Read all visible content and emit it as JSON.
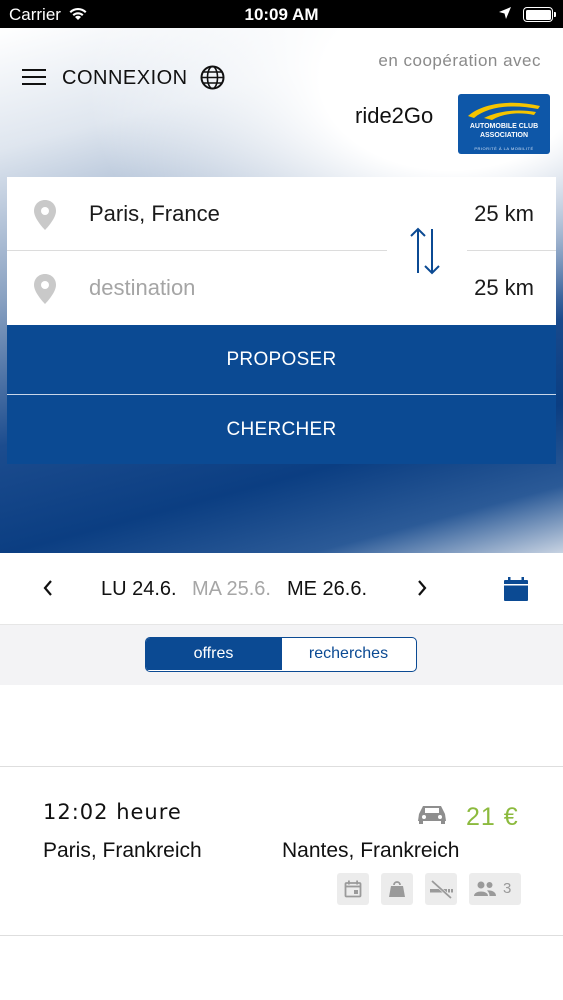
{
  "status_bar": {
    "carrier": "Carrier",
    "time": "10:09 AM"
  },
  "header": {
    "login_label": "CONNEXION",
    "cooperation_text": "en coopération avec",
    "partner_name": "ride2Go",
    "partner_logo": {
      "line1": "AUTOMOBILE CLUB",
      "line2": "ASSOCIATION",
      "tagline": "PRIORITÉ À LA MOBILITÉ"
    },
    "icons": [
      "menu-icon",
      "globe-icon"
    ]
  },
  "search": {
    "origin_value": "Paris, France",
    "origin_radius": "25 km",
    "destination_placeholder": "destination",
    "destination_radius": "25 km"
  },
  "actions": {
    "propose_label": "PROPOSER",
    "search_label": "CHERCHER"
  },
  "date_bar": {
    "prev": "LU 24.6.",
    "current": "MA 25.6.",
    "next": "ME 26.6."
  },
  "tabs": {
    "offers": "offres",
    "requests": "recherches",
    "active": "offres"
  },
  "rides": [
    {
      "time": "12:02 heure",
      "price": "21 €",
      "from": "Paris, Frankreich",
      "to": "Nantes, Frankreich",
      "seats": "3",
      "icons": [
        "calendar-icon",
        "bag-icon",
        "no-smoking-icon",
        "people-icon"
      ]
    }
  ],
  "colors": {
    "primary": "#0b4a93",
    "price": "#8cba3e",
    "muted": "#a6a6a6"
  }
}
